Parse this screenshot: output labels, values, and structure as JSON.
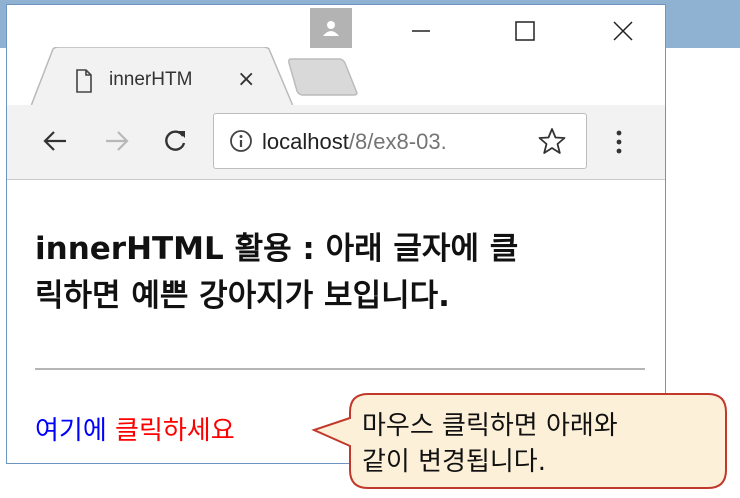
{
  "browser": {
    "tab": {
      "title": "innerHTM",
      "close_glyph": "×"
    },
    "window_controls": {
      "minimize": "—",
      "maximize": "☐",
      "close": "✕"
    },
    "address": {
      "host": "localhost",
      "path": "/8/ex8-03."
    },
    "icons": [
      "profile-icon",
      "page-icon",
      "back-arrow-icon",
      "forward-arrow-icon",
      "reload-icon",
      "info-icon",
      "star-icon",
      "menu-icon"
    ]
  },
  "page": {
    "heading_line1": "innerHTML 활용 : 아래 글자에 클",
    "heading_line2": "릭하면 예쁜 강아지가 보입니다.",
    "click_text_blue": "여기에 ",
    "click_text_red": "클릭하세요"
  },
  "callout": {
    "line1": "마우스 클릭하면 아래와",
    "line2": "같이 변경됩니다."
  },
  "colors": {
    "band": "#8fb2d3",
    "window_border": "#6f94c2",
    "link_blue": "#0000ff",
    "link_red": "#ff0000",
    "callout_fill": "#fdf0d9",
    "callout_border": "#c0392b"
  }
}
